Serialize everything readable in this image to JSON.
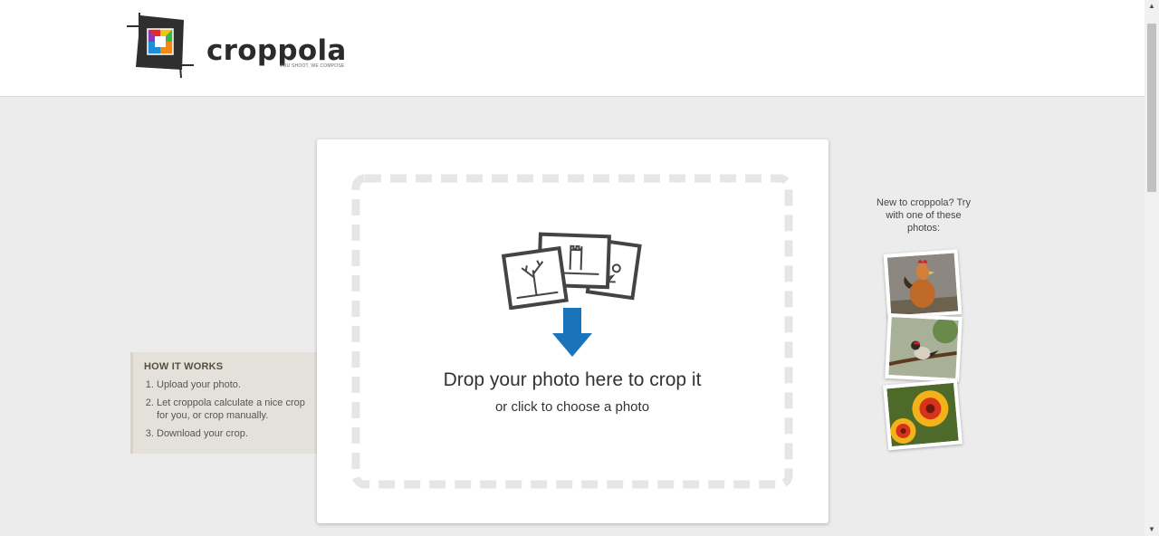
{
  "header": {
    "logo_text": "croppola",
    "logo_tagline": "YOU SHOOT, WE COMPOSE"
  },
  "how_it_works": {
    "title": "HOW IT WORKS",
    "steps": [
      "Upload your photo.",
      "Let croppola calculate a nice crop for you, or crop manually.",
      "Download your crop."
    ]
  },
  "dropzone": {
    "title": "Drop your photo here to crop it",
    "subtitle": "or click to choose a photo",
    "icons": [
      "photos-stack-icon",
      "arrow-down-icon"
    ]
  },
  "samples": {
    "prompt": "New to croppola? Try with one of these photos:",
    "photos": [
      "rooster",
      "bird",
      "flowers"
    ]
  },
  "scrollbar": {
    "up": "▲",
    "down": "▼"
  },
  "colors": {
    "arrow": "#1a74ba",
    "how_bg": "#e4e1da",
    "page_bg": "#ececec"
  }
}
